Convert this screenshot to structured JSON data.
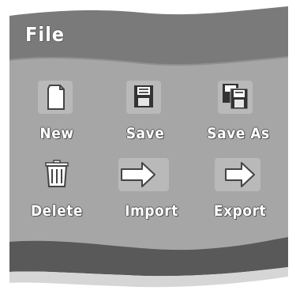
{
  "window": {
    "title": "File"
  },
  "actions": [
    {
      "label": "New",
      "icon": "new-document-icon"
    },
    {
      "label": "Save",
      "icon": "floppy-disk-icon"
    },
    {
      "label": "Save As",
      "icon": "save-as-icon"
    },
    {
      "label": "Delete",
      "icon": "trash-icon"
    },
    {
      "label": "Import",
      "icon": "arrow-right-icon"
    },
    {
      "label": "Export",
      "icon": "arrow-right-icon"
    }
  ],
  "colors": {
    "panel": "#a6a6a6",
    "header": "#7a7a7a",
    "footer": "#595959",
    "text": "#ffffff"
  }
}
